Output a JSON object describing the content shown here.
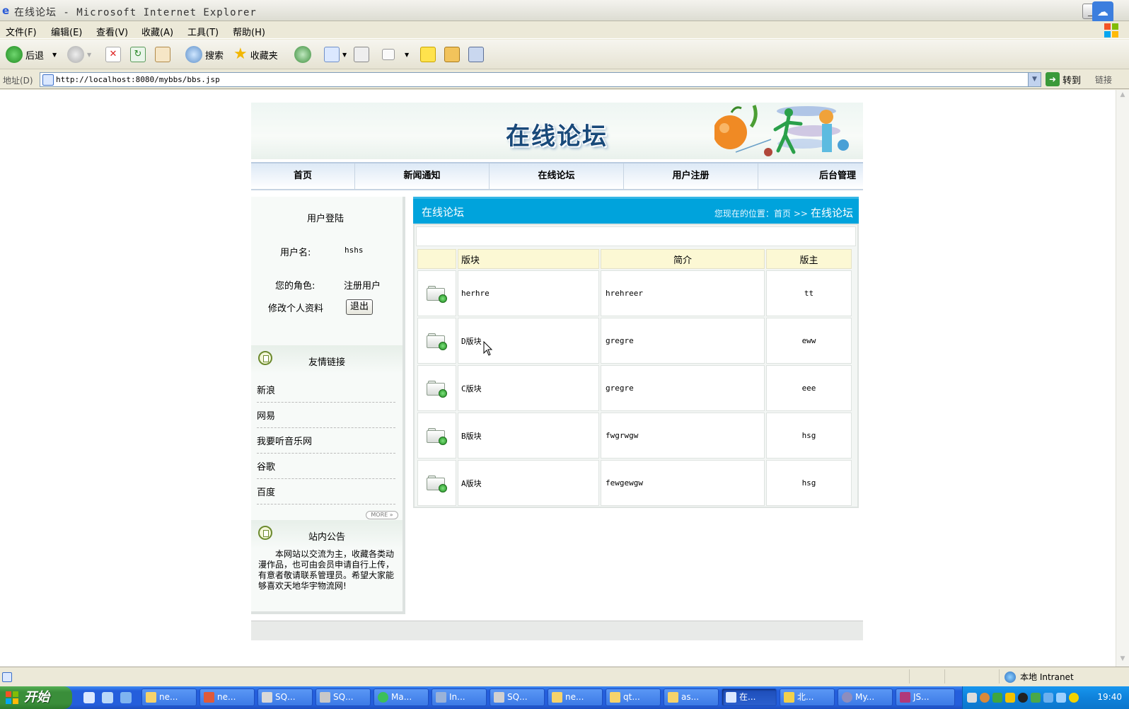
{
  "window": {
    "title": "在线论坛 - Microsoft Internet Explorer"
  },
  "menu": [
    "文件(F)",
    "编辑(E)",
    "查看(V)",
    "收藏(A)",
    "工具(T)",
    "帮助(H)"
  ],
  "toolbar": {
    "back": "后退",
    "search": "搜索",
    "favorites": "收藏夹"
  },
  "address": {
    "label": "地址(D)",
    "url": "http://localhost:8080/mybbs/bbs.jsp",
    "go": "转到",
    "links": "链接"
  },
  "site": {
    "logo": "在线论坛",
    "nav": [
      "首页",
      "新闻通知",
      "在线论坛",
      "用户注册",
      "后台管理"
    ],
    "login": {
      "title": "用户登陆",
      "username_label": "用户名:",
      "username_value": "hshs",
      "role_label": "您的角色:",
      "role_value": "注册用户",
      "edit_profile": "修改个人资料",
      "logout": "退出"
    },
    "friend_links": {
      "title": "友情链接",
      "items": [
        "新浪",
        "网易",
        "我要听音乐网",
        "谷歌",
        "百度"
      ],
      "more": "MORE »"
    },
    "notice": {
      "title": "站内公告",
      "text": "本网站以交流为主，收藏各类动漫作品，也可由会员申请自行上传，有意者敬请联系管理员。希望大家能够喜欢天地华宇物流网!"
    },
    "forum": {
      "title": "在线论坛",
      "breadcrumb_prefix": "您现在的位置：首页",
      "breadcrumb_sep": ">>",
      "breadcrumb_current": "在线论坛",
      "columns": [
        "版块",
        "简介",
        "版主"
      ],
      "rows": [
        {
          "name": "herhre",
          "desc": "hrehreer",
          "moderator": "tt"
        },
        {
          "name": "D版块",
          "desc": "gregre",
          "moderator": "eww"
        },
        {
          "name": "C版块",
          "desc": "gregre",
          "moderator": "eee"
        },
        {
          "name": "B版块",
          "desc": "fwgrwgw",
          "moderator": "hsg"
        },
        {
          "name": "A版块",
          "desc": "fewgewgw",
          "moderator": "hsg"
        }
      ]
    }
  },
  "statusbar": {
    "zone": "本地 Intranet"
  },
  "taskbar": {
    "start": "开始",
    "tasks": [
      "ne...",
      "ne...",
      "SQ...",
      "SQ...",
      "Ma...",
      "In...",
      "SQ...",
      "ne...",
      "qt...",
      "as...",
      "在...",
      "北...",
      "My...",
      "JS..."
    ],
    "clock": "19:40"
  },
  "colors": {
    "forum_header": "#00a3dc",
    "table_header": "#fcf8d4",
    "taskbar": "#245edc",
    "start_button": "#3a8e3a"
  }
}
